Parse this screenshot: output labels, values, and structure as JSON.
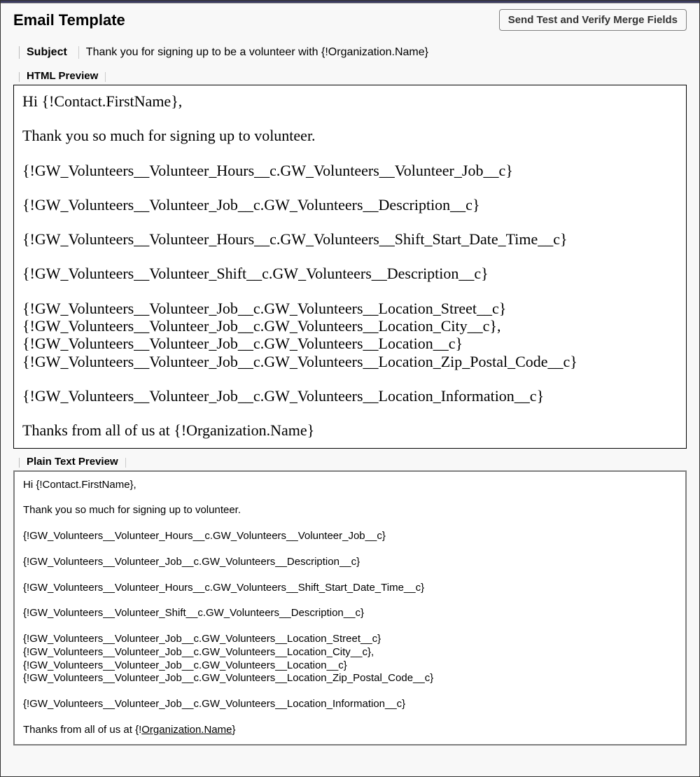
{
  "header": {
    "page_title": "Email Template",
    "send_test_label": "Send Test and Verify Merge Fields"
  },
  "subject": {
    "label": "Subject",
    "value": "Thank you for signing up to be a volunteer with {!Organization.Name}"
  },
  "html_preview": {
    "tab_label": "HTML Preview",
    "line1": "Hi {!Contact.FirstName},",
    "line2": "Thank you so much for signing up to volunteer.",
    "line3": "{!GW_Volunteers__Volunteer_Hours__c.GW_Volunteers__Volunteer_Job__c}",
    "line4": "{!GW_Volunteers__Volunteer_Job__c.GW_Volunteers__Description__c}",
    "line5": "{!GW_Volunteers__Volunteer_Hours__c.GW_Volunteers__Shift_Start_Date_Time__c}",
    "line6": "{!GW_Volunteers__Volunteer_Shift__c.GW_Volunteers__Description__c}",
    "line7": "{!GW_Volunteers__Volunteer_Job__c.GW_Volunteers__Location_Street__c}",
    "line8": "{!GW_Volunteers__Volunteer_Job__c.GW_Volunteers__Location_City__c},",
    "line9": "{!GW_Volunteers__Volunteer_Job__c.GW_Volunteers__Location__c}",
    "line10": "{!GW_Volunteers__Volunteer_Job__c.GW_Volunteers__Location_Zip_Postal_Code__c}",
    "line11": "{!GW_Volunteers__Volunteer_Job__c.GW_Volunteers__Location_Information__c}",
    "line12": "Thanks from all of us at {!Organization.Name}"
  },
  "plain_text": {
    "tab_label": "Plain Text Preview",
    "line1": "Hi {!Contact.FirstName},",
    "line2": "Thank you so much for signing up to volunteer.",
    "line3": "{!GW_Volunteers__Volunteer_Hours__c.GW_Volunteers__Volunteer_Job__c}",
    "line4": "{!GW_Volunteers__Volunteer_Job__c.GW_Volunteers__Description__c}",
    "line5": "{!GW_Volunteers__Volunteer_Hours__c.GW_Volunteers__Shift_Start_Date_Time__c}",
    "line6": "{!GW_Volunteers__Volunteer_Shift__c.GW_Volunteers__Description__c}",
    "line7": "{!GW_Volunteers__Volunteer_Job__c.GW_Volunteers__Location_Street__c}",
    "line8": "{!GW_Volunteers__Volunteer_Job__c.GW_Volunteers__Location_City__c},",
    "line9": "{!GW_Volunteers__Volunteer_Job__c.GW_Volunteers__Location__c}",
    "line10": "{!GW_Volunteers__Volunteer_Job__c.GW_Volunteers__Location_Zip_Postal_Code__c}",
    "line12a": "Thanks from all of us at {!",
    "line11": "{!GW_Volunteers__Volunteer_Job__c.GW_Volunteers__Location_Information__c}",
    "line12b": "Organization.Name",
    "line12c": "}"
  }
}
